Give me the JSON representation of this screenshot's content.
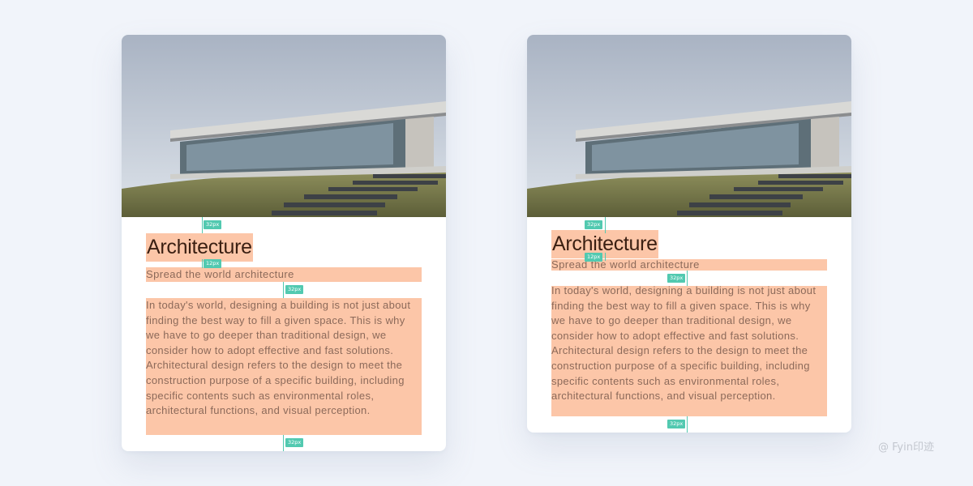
{
  "cards": [
    {
      "title": "Architecture",
      "subtitle": "Spread the world architecture",
      "paragraphs": [
        "In today's world, designing a building is not just about finding the best way to fill a given space. This is why we have to go deeper than traditional design, we consider how to adopt effective and fast solutions.",
        "Architectural design refers to the design to meet the construction purpose of a specific building, including specific contents such as environmental roles, architectural functions, and visual perception."
      ],
      "spacing_labels": [
        "32px",
        "12px",
        "32px",
        "32px"
      ]
    },
    {
      "title": "Architecture",
      "subtitle": "Spread the world architecture",
      "paragraphs": [
        "In today's world, designing a building is not just about finding the best way to fill a given space. This is why we have to go deeper than traditional design, we consider how to adopt effective and fast solutions.",
        "Architectural design refers to the design to meet the construction purpose of a specific building, including specific contents such as environmental roles, architectural functions, and visual perception."
      ],
      "spacing_labels": [
        "32px",
        "12px",
        "32px",
        "32px"
      ]
    }
  ],
  "watermark": "@ Fyin印迹",
  "colors": {
    "background": "#f1f4fa",
    "highlight": "#fcc6a8",
    "title": "#3a1f12",
    "body_text": "#8c6a5a",
    "guide": "#52c9b0"
  }
}
